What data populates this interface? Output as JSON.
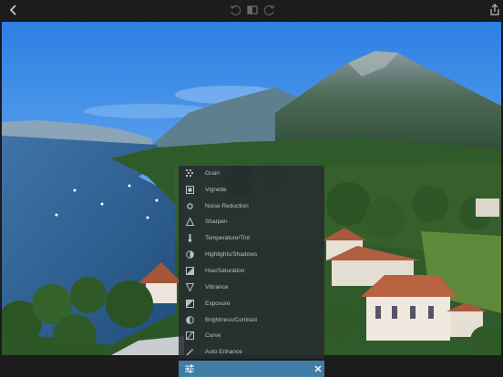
{
  "topbar": {
    "icons": [
      "undo-icon",
      "compare-icon",
      "redo-icon",
      "share-icon"
    ]
  },
  "menu": {
    "items": [
      {
        "label": "Grain",
        "icon": "grain-icon"
      },
      {
        "label": "Vignette",
        "icon": "vignette-icon"
      },
      {
        "label": "Noise Reduction",
        "icon": "noise-reduction-icon"
      },
      {
        "label": "Sharpen",
        "icon": "sharpen-icon"
      },
      {
        "label": "Temperature/Tint",
        "icon": "thermometer-icon"
      },
      {
        "label": "Highlights/Shadows",
        "icon": "highlights-shadows-icon"
      },
      {
        "label": "Hue/Saturation",
        "icon": "hue-saturation-icon"
      },
      {
        "label": "Vibrance",
        "icon": "vibrance-icon"
      },
      {
        "label": "Exposure",
        "icon": "exposure-icon"
      },
      {
        "label": "Brightness/Contrast",
        "icon": "brightness-contrast-icon"
      },
      {
        "label": "Curve",
        "icon": "curve-icon"
      },
      {
        "label": "Auto Enhance",
        "icon": "magic-wand-icon"
      }
    ]
  },
  "footer": {
    "icons": [
      "adjustments-icon",
      "close-icon"
    ]
  },
  "colors": {
    "accent": "#3f7da7",
    "menu_text": "#b9c0c8",
    "toolbar_bg": "#1c1c1c"
  }
}
